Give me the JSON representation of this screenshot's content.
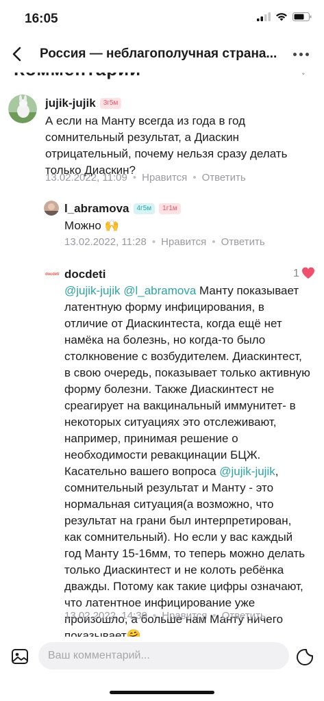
{
  "status_bar": {
    "time": "16:05"
  },
  "header": {
    "title": "Россия — неблагополучная страна..."
  },
  "section": {
    "title": "Комментарии"
  },
  "comments": [
    {
      "author": "jujik-jujik",
      "badges": [
        "3г5м"
      ],
      "text": "А если на Манту всегда из года в год сомнительный результат, а Диаскин отрицательный, почему нельзя сразу делать только Диаскин?",
      "date": "13.02.2022, 11:09",
      "like_label": "Нравится",
      "reply_label": "Ответить"
    },
    {
      "author": "l_abramova",
      "badges": [
        "4г5м",
        "1г1м"
      ],
      "text": "Можно 🙌",
      "date": "13.02.2022, 11:28",
      "like_label": "Нравится",
      "reply_label": "Ответить"
    },
    {
      "author": "docdeti",
      "avatar_text": "docdeti",
      "likes": "1",
      "mention1": "@jujik-jujik",
      "mention2": "@l_abramova",
      "text_part1": " Манту показывает латентную форму инфицирования, в отличие от Диаскинтеста, когда ещё нет намёка на болезнь, но когда-то было столкновение с возбудителем. Диаскинтест, в свою очередь, показывает только активную форму болезни. Также Диаскинтест не среагирует на вакцинальный иммунитет- в некоторых ситуациях это отслеживают, например, принимая решение о необходимости ревакцинации БЦЖ.",
      "text_part2": "Касательно вашего вопроса ",
      "mention3": "@jujik-jujik",
      "text_part3": ", сомнительный результат и Манту - это нормальная ситуация(а возможно, что результат на грани был интерпретирован, как сомнительный). Но если у вас каждый год Манту 15-16мм, то теперь можно делать только Диаскинтест и не колоть ребёнка дважды. Потому как такие цифры означают, что латентное инфицирование уже произошло, а больше нам Манту ничего показывает🤗",
      "date": "13.02.2022, 14:30",
      "like_label": "Нравится",
      "reply_label": "Ответить"
    }
  ],
  "composer": {
    "placeholder": "Ваш комментарий..."
  },
  "colors": {
    "mention": "#2ea3a3",
    "heart": "#f0506e",
    "meta": "#9a9aa0"
  }
}
